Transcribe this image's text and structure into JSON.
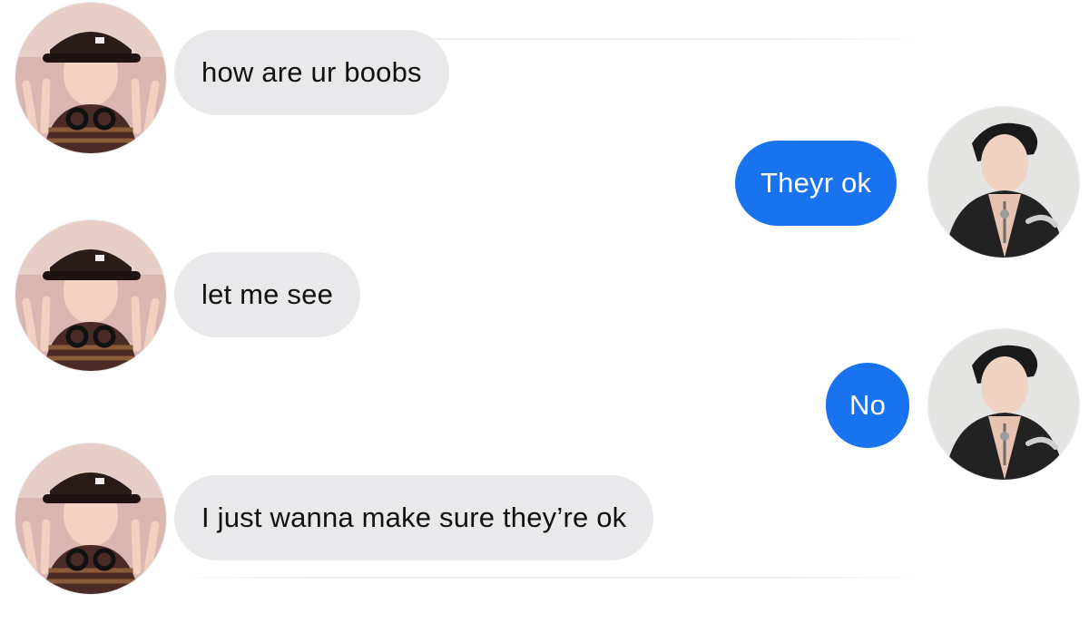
{
  "thread": {
    "messages": [
      {
        "sender": "incoming",
        "text": "how are ur boobs"
      },
      {
        "sender": "outgoing",
        "text": "Theyr ok"
      },
      {
        "sender": "incoming",
        "text": "let me see"
      },
      {
        "sender": "outgoing",
        "text": "No"
      },
      {
        "sender": "incoming",
        "text": "I just wanna make sure they’re ok"
      }
    ]
  },
  "avatars": {
    "incoming_icon": "person-with-cap-peace-sign-photo",
    "outgoing_icon": "person-in-leather-jacket-photo"
  },
  "colors": {
    "incoming_bubble": "#e9e9eb",
    "outgoing_bubble": "#1a73ee",
    "incoming_text": "#111111",
    "outgoing_text": "#ffffff",
    "background": "#ffffff"
  }
}
